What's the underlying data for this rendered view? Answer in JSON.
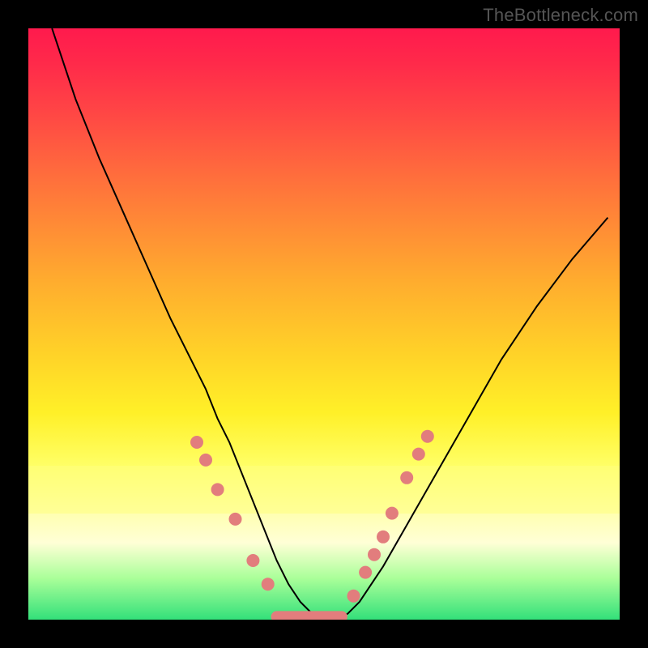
{
  "watermark": "TheBottleneck.com",
  "colors": {
    "background": "#000000",
    "dot": "#e27d7d",
    "curve": "#000000",
    "gradient_top": "#ff1a4d",
    "gradient_bottom": "#33e07a",
    "highlight": "#ffff80"
  },
  "chart_data": {
    "type": "line",
    "title": "",
    "xlabel": "",
    "ylabel": "",
    "xlim": [
      0,
      100
    ],
    "ylim": [
      0,
      100
    ],
    "grid": false,
    "legend": false,
    "series": [
      {
        "name": "bottleneck-curve",
        "x": [
          4,
          8,
          12,
          16,
          20,
          24,
          28,
          30,
          32,
          34,
          36,
          38,
          40,
          42,
          44,
          46,
          48,
          50,
          52,
          54,
          56,
          60,
          64,
          68,
          72,
          76,
          80,
          86,
          92,
          98
        ],
        "y": [
          100,
          88,
          78,
          69,
          60,
          51,
          43,
          39,
          34,
          30,
          25,
          20,
          15,
          10,
          6,
          3,
          1,
          0,
          0,
          1,
          3,
          9,
          16,
          23,
          30,
          37,
          44,
          53,
          61,
          68
        ]
      }
    ],
    "markers": [
      {
        "name": "left-dot-1",
        "x": 28.5,
        "y": 30
      },
      {
        "name": "left-dot-2",
        "x": 30.0,
        "y": 27
      },
      {
        "name": "left-dot-3",
        "x": 32.0,
        "y": 22
      },
      {
        "name": "left-dot-4",
        "x": 35.0,
        "y": 17
      },
      {
        "name": "left-dot-5",
        "x": 38.0,
        "y": 10
      },
      {
        "name": "left-dot-6",
        "x": 40.5,
        "y": 6
      },
      {
        "name": "right-dot-1",
        "x": 55.0,
        "y": 4
      },
      {
        "name": "right-dot-2",
        "x": 57.0,
        "y": 8
      },
      {
        "name": "right-dot-3",
        "x": 58.5,
        "y": 11
      },
      {
        "name": "right-dot-4",
        "x": 60.0,
        "y": 14
      },
      {
        "name": "right-dot-5",
        "x": 61.5,
        "y": 18
      },
      {
        "name": "right-dot-6",
        "x": 64.0,
        "y": 24
      },
      {
        "name": "right-dot-7",
        "x": 66.0,
        "y": 28
      },
      {
        "name": "right-dot-8",
        "x": 67.5,
        "y": 31
      }
    ],
    "bottom_segment": {
      "x0": 42,
      "x1": 53,
      "y": 0.5
    },
    "annotations": []
  }
}
